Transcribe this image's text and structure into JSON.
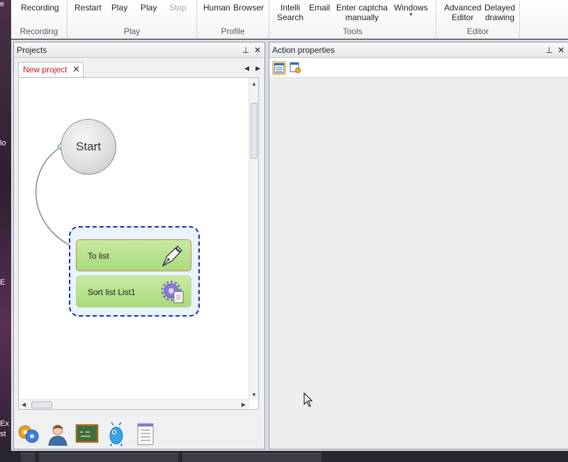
{
  "ribbon": {
    "groups": [
      {
        "label": "Recording",
        "buttons": [
          "Recording"
        ]
      },
      {
        "label": "Play",
        "buttons": [
          "Restart",
          "Play",
          "Play",
          "Stop"
        ]
      },
      {
        "label": "Profile",
        "buttons": [
          "Human",
          "Browser"
        ]
      },
      {
        "label": "Tools",
        "buttons": [
          "Intelli\nSearch",
          "Email",
          "Enter captcha\nmanually",
          "Windows"
        ]
      },
      {
        "label": "Editor",
        "buttons": [
          "Advanced\nEditor",
          "Delayed\ndrawing"
        ]
      }
    ]
  },
  "projects_pane": {
    "title": "Projects",
    "pin": "⊥",
    "close": "✕",
    "tab_label": "New project",
    "tab_close": "✕"
  },
  "canvas": {
    "start_label": "Start",
    "actions": [
      {
        "label": "To list",
        "icon": "pen-icon"
      },
      {
        "label": "Sort list List1",
        "icon": "gear-document-icon"
      }
    ]
  },
  "toolbox": [
    "puzzle-icon",
    "human-icon",
    "blackboard-icon",
    "robot-icon",
    "document-list-icon"
  ],
  "action_props_pane": {
    "title": "Action properties",
    "pin": "⊥",
    "close": "✕",
    "toolbar": [
      "properties-grid-icon",
      "properties-settings-icon"
    ]
  },
  "desktop_fragments": [
    "e",
    "lo",
    "E",
    "Ex",
    "st"
  ],
  "colors": {
    "selection_border": "#e0301c",
    "group_border": "#1b23c8",
    "action_fill": "#b4e08c",
    "tab_text": "#c01818"
  }
}
